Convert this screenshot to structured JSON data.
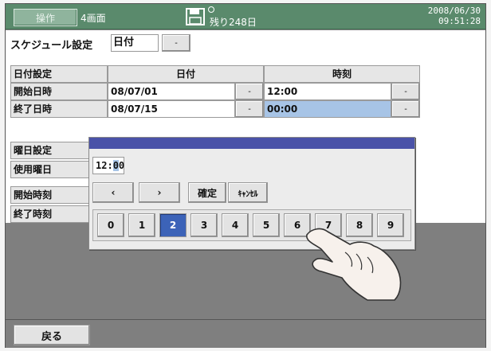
{
  "header": {
    "operate_label": "操作",
    "screen_count": "4画面",
    "remaining": "残り248日",
    "date": "2008/06/30",
    "time": "09:51:28",
    "icons": [
      "floppy-disk-icon",
      "circle-icon"
    ]
  },
  "schedule": {
    "label": "スケジュール設定",
    "selected": "日付",
    "dropdown_glyph": "-"
  },
  "date_table": {
    "row_header": "日付設定",
    "date_header": "日付",
    "time_header": "時刻",
    "rows": [
      {
        "label": "開始日時",
        "date": "08/07/01",
        "time": "12:00"
      },
      {
        "label": "終了日時",
        "date": "08/07/15",
        "time": "00:00"
      }
    ]
  },
  "lower_labels": [
    "曜日設定",
    "使用曜日",
    "開始時刻",
    "終了時刻"
  ],
  "popup": {
    "value_prefix": "12:",
    "value_caret": "0",
    "value_suffix": "0",
    "left_arrow": "‹",
    "right_arrow": "›",
    "confirm": "確定",
    "cancel": "ｷｬﾝｾﾙ",
    "digits": [
      "0",
      "1",
      "2",
      "3",
      "4",
      "5",
      "6",
      "7",
      "8",
      "9"
    ],
    "active_digit": "2"
  },
  "footer": {
    "back_label": "戻る"
  },
  "colors": {
    "header": "#5a8a6c",
    "selection": "#a7c4e6",
    "popup_title": "#4a52a8",
    "active_key": "#3c63b8"
  }
}
